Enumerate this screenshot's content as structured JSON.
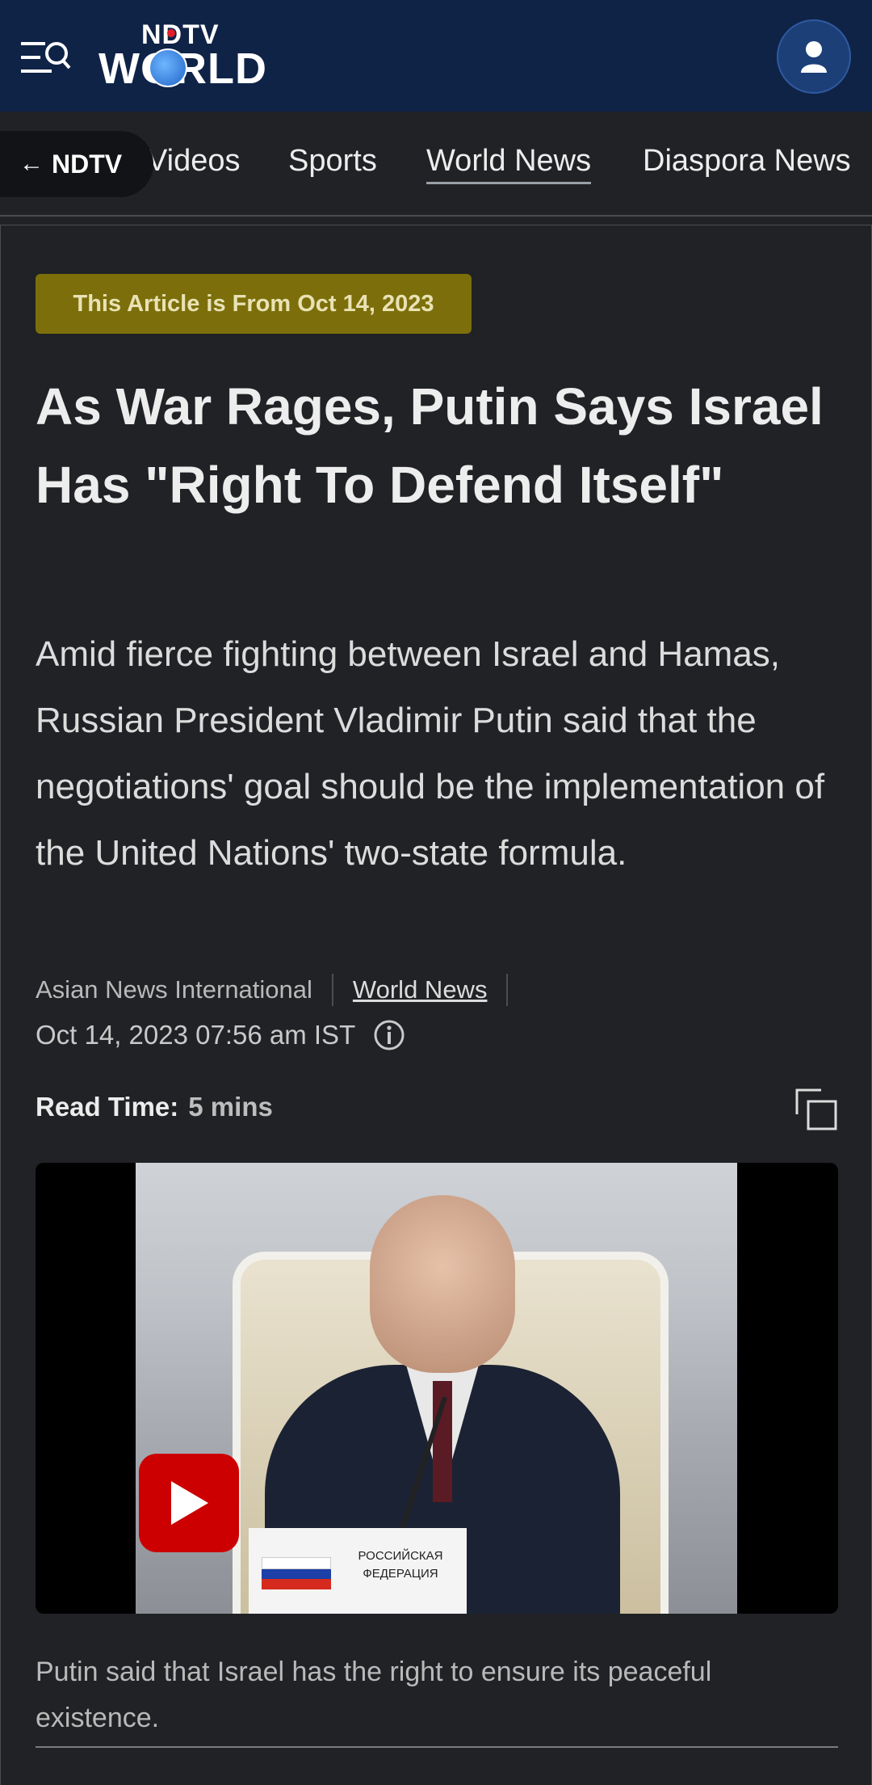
{
  "header": {
    "logo_top": "NDTV",
    "logo_bottom": "WORLD",
    "menu_icon": "menu-search-icon",
    "profile_icon": "user-icon"
  },
  "nav": {
    "back_label": "NDTV",
    "items": [
      "Videos",
      "Sports",
      "World News",
      "Diaspora News"
    ],
    "active": "World News"
  },
  "article": {
    "date_badge": "This Article is From Oct 14, 2023",
    "headline": "As War Rages, Putin Says Israel Has \"Right To Defend Itself\"",
    "summary": "Amid fierce fighting between Israel and Hamas, Russian President Vladimir Putin said that the negotiations' goal should be the implementation of the United Nations' two-state formula.",
    "source": "Asian News International",
    "category": "World News",
    "datetime": "Oct 14, 2023 07:56 am IST",
    "read_time_label": "Read Time:",
    "read_time_value": "5 mins",
    "video": {
      "placard_text": "РОССИЙСКАЯ ФЕДЕРАЦИЯ",
      "play_icon": "play-icon"
    },
    "caption": "Putin said that Israel has the right to ensure its peaceful existence."
  },
  "colors": {
    "header_bg": "#0f2347",
    "page_bg": "#202225",
    "badge_bg": "#7c6f0b",
    "play_red": "#cc0000"
  }
}
